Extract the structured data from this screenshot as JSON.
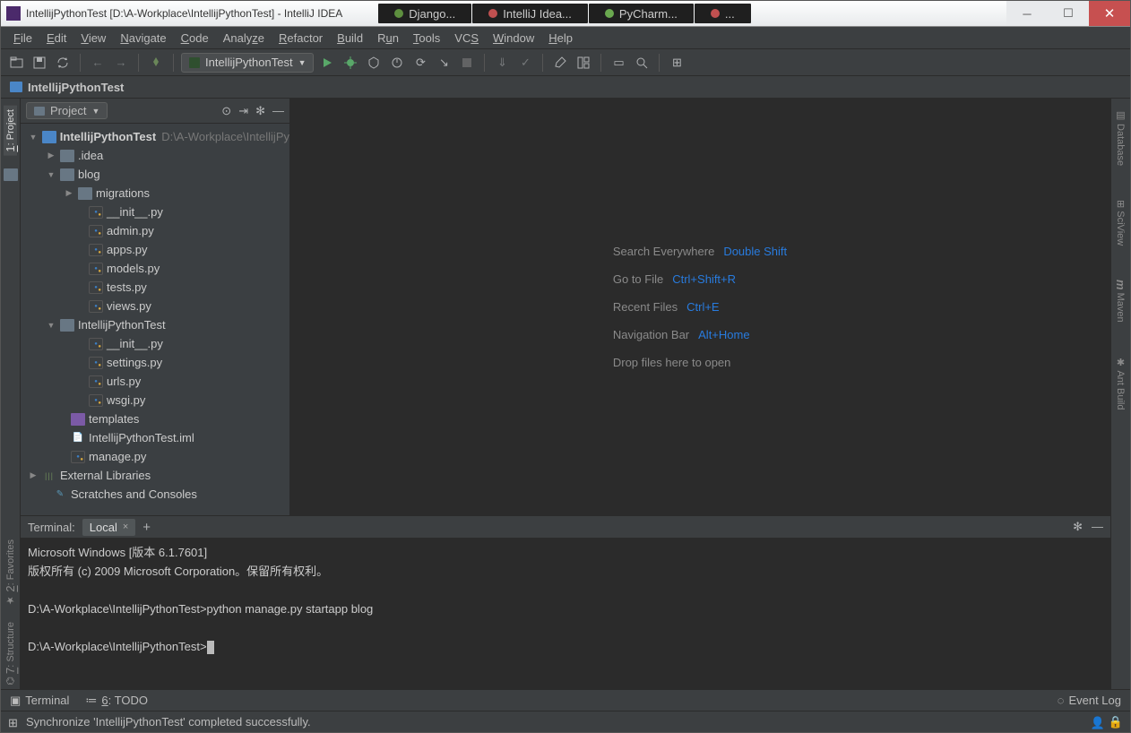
{
  "window": {
    "title": "IntellijPythonTest [D:\\A-Workplace\\IntellijPythonTest] - IntelliJ IDEA"
  },
  "os_tabs": [
    {
      "label": "Django...",
      "color": "#5e8f3f"
    },
    {
      "label": "IntelliJ Idea...",
      "color": "#c05050"
    },
    {
      "label": "PyCharm...",
      "color": "#6aa84f"
    },
    {
      "label": "...",
      "color": "#c05050"
    }
  ],
  "menubar": [
    "File",
    "Edit",
    "View",
    "Navigate",
    "Code",
    "Analyze",
    "Refactor",
    "Build",
    "Run",
    "Tools",
    "VCS",
    "Window",
    "Help"
  ],
  "run_config": "IntellijPythonTest",
  "breadcrumb": "IntellijPythonTest",
  "project_view": {
    "selector": "Project"
  },
  "tree": {
    "root": {
      "name": "IntellijPythonTest",
      "path": "D:\\A-Workplace\\IntellijPy"
    },
    "idea": ".idea",
    "blog": "blog",
    "migrations": "migrations",
    "files_blog": [
      "__init__.py",
      "admin.py",
      "apps.py",
      "models.py",
      "tests.py",
      "views.py"
    ],
    "pkg": "IntellijPythonTest",
    "files_pkg": [
      "__init__.py",
      "settings.py",
      "urls.py",
      "wsgi.py"
    ],
    "templates": "templates",
    "iml": "IntellijPythonTest.iml",
    "manage": "manage.py",
    "ext": "External Libraries",
    "scratch": "Scratches and Consoles"
  },
  "empty_editor": {
    "rows": [
      {
        "lbl": "Search Everywhere",
        "key": "Double Shift"
      },
      {
        "lbl": "Go to File",
        "key": "Ctrl+Shift+R"
      },
      {
        "lbl": "Recent Files",
        "key": "Ctrl+E"
      },
      {
        "lbl": "Navigation Bar",
        "key": "Alt+Home"
      }
    ],
    "drop": "Drop files here to open"
  },
  "terminal": {
    "label": "Terminal:",
    "tab": "Local",
    "lines": [
      "Microsoft Windows [版本 6.1.7601]",
      "版权所有 (c) 2009 Microsoft Corporation。保留所有权利。",
      "",
      "D:\\A-Workplace\\IntellijPythonTest>python manage.py startapp blog",
      "",
      "D:\\A-Workplace\\IntellijPythonTest>"
    ]
  },
  "left_tools": [
    "1: Project"
  ],
  "left_tools_bottom": [
    "2: Favorites",
    "7: Structure"
  ],
  "right_tools": [
    "Database",
    "SciView",
    "Maven",
    "Ant Build"
  ],
  "bottom_tools": {
    "terminal": "Terminal",
    "todo": "6: TODO",
    "eventlog": "Event Log"
  },
  "status": "Synchronize 'IntellijPythonTest' completed successfully."
}
